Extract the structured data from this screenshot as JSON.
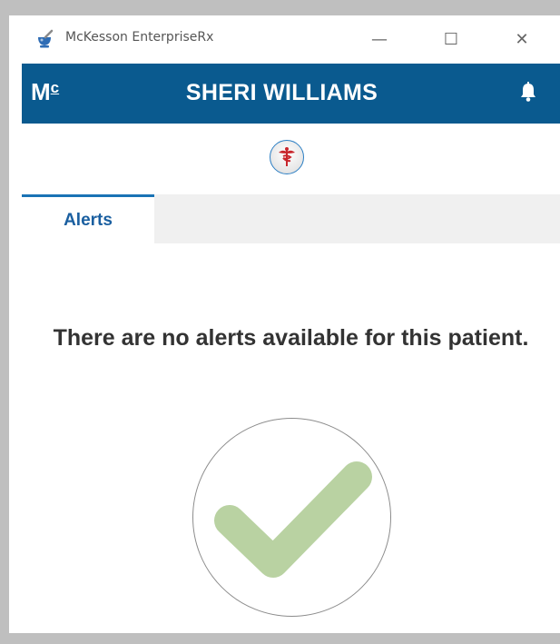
{
  "window": {
    "title": "McKesson EnterpriseRx",
    "app_icon": "mortar-pestle-icon",
    "controls": {
      "minimize": "—",
      "maximize": "☐",
      "close": "✕"
    }
  },
  "header": {
    "logo_text": "M",
    "logo_sub": "c",
    "patient_name": "SHERI WILLIAMS",
    "bell_icon": "bell-icon"
  },
  "rx_button": {
    "icon": "caduceus-icon"
  },
  "tabs": [
    {
      "label": "Alerts",
      "active": true
    }
  ],
  "alerts": {
    "message": "There are no alerts available for this patient.",
    "status_icon": "checkmark-icon",
    "check_color": "#b9d2a2"
  },
  "colors": {
    "brand_header": "#0a5a8f",
    "tab_active_accent": "#1a73b5"
  }
}
